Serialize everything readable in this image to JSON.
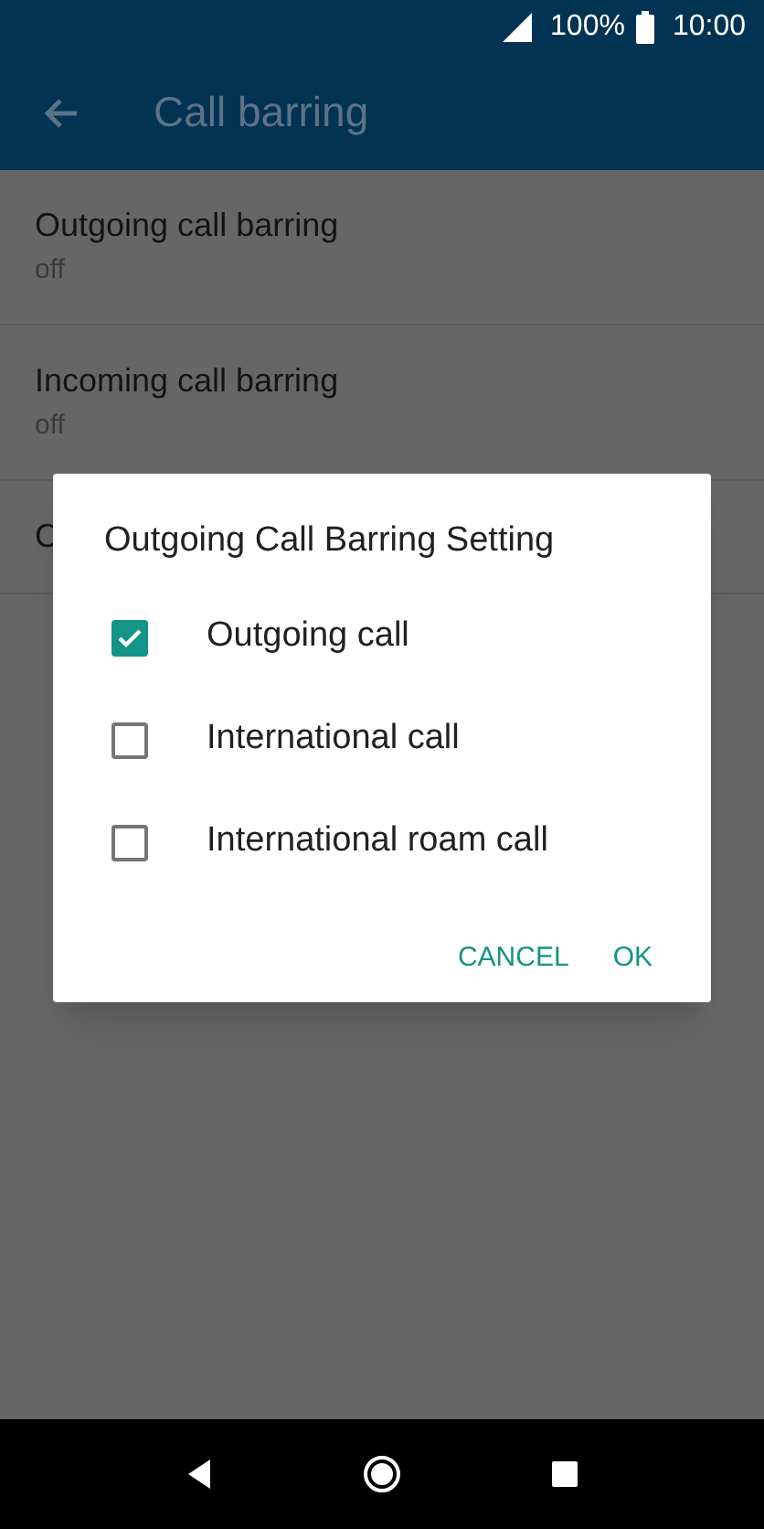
{
  "status_bar": {
    "battery": "100%",
    "time": "10:00"
  },
  "app_bar": {
    "title": "Call barring"
  },
  "settings": [
    {
      "title": "Outgoing call barring",
      "summary": "off"
    },
    {
      "title": "Incoming call barring",
      "summary": "off"
    },
    {
      "title": "C"
    }
  ],
  "dialog": {
    "title": "Outgoing Call Barring Setting",
    "options": [
      {
        "label": "Outgoing call",
        "checked": true
      },
      {
        "label": "International call",
        "checked": false
      },
      {
        "label": "International roam call",
        "checked": false
      }
    ],
    "buttons": [
      "CANCEL",
      "OK"
    ]
  }
}
